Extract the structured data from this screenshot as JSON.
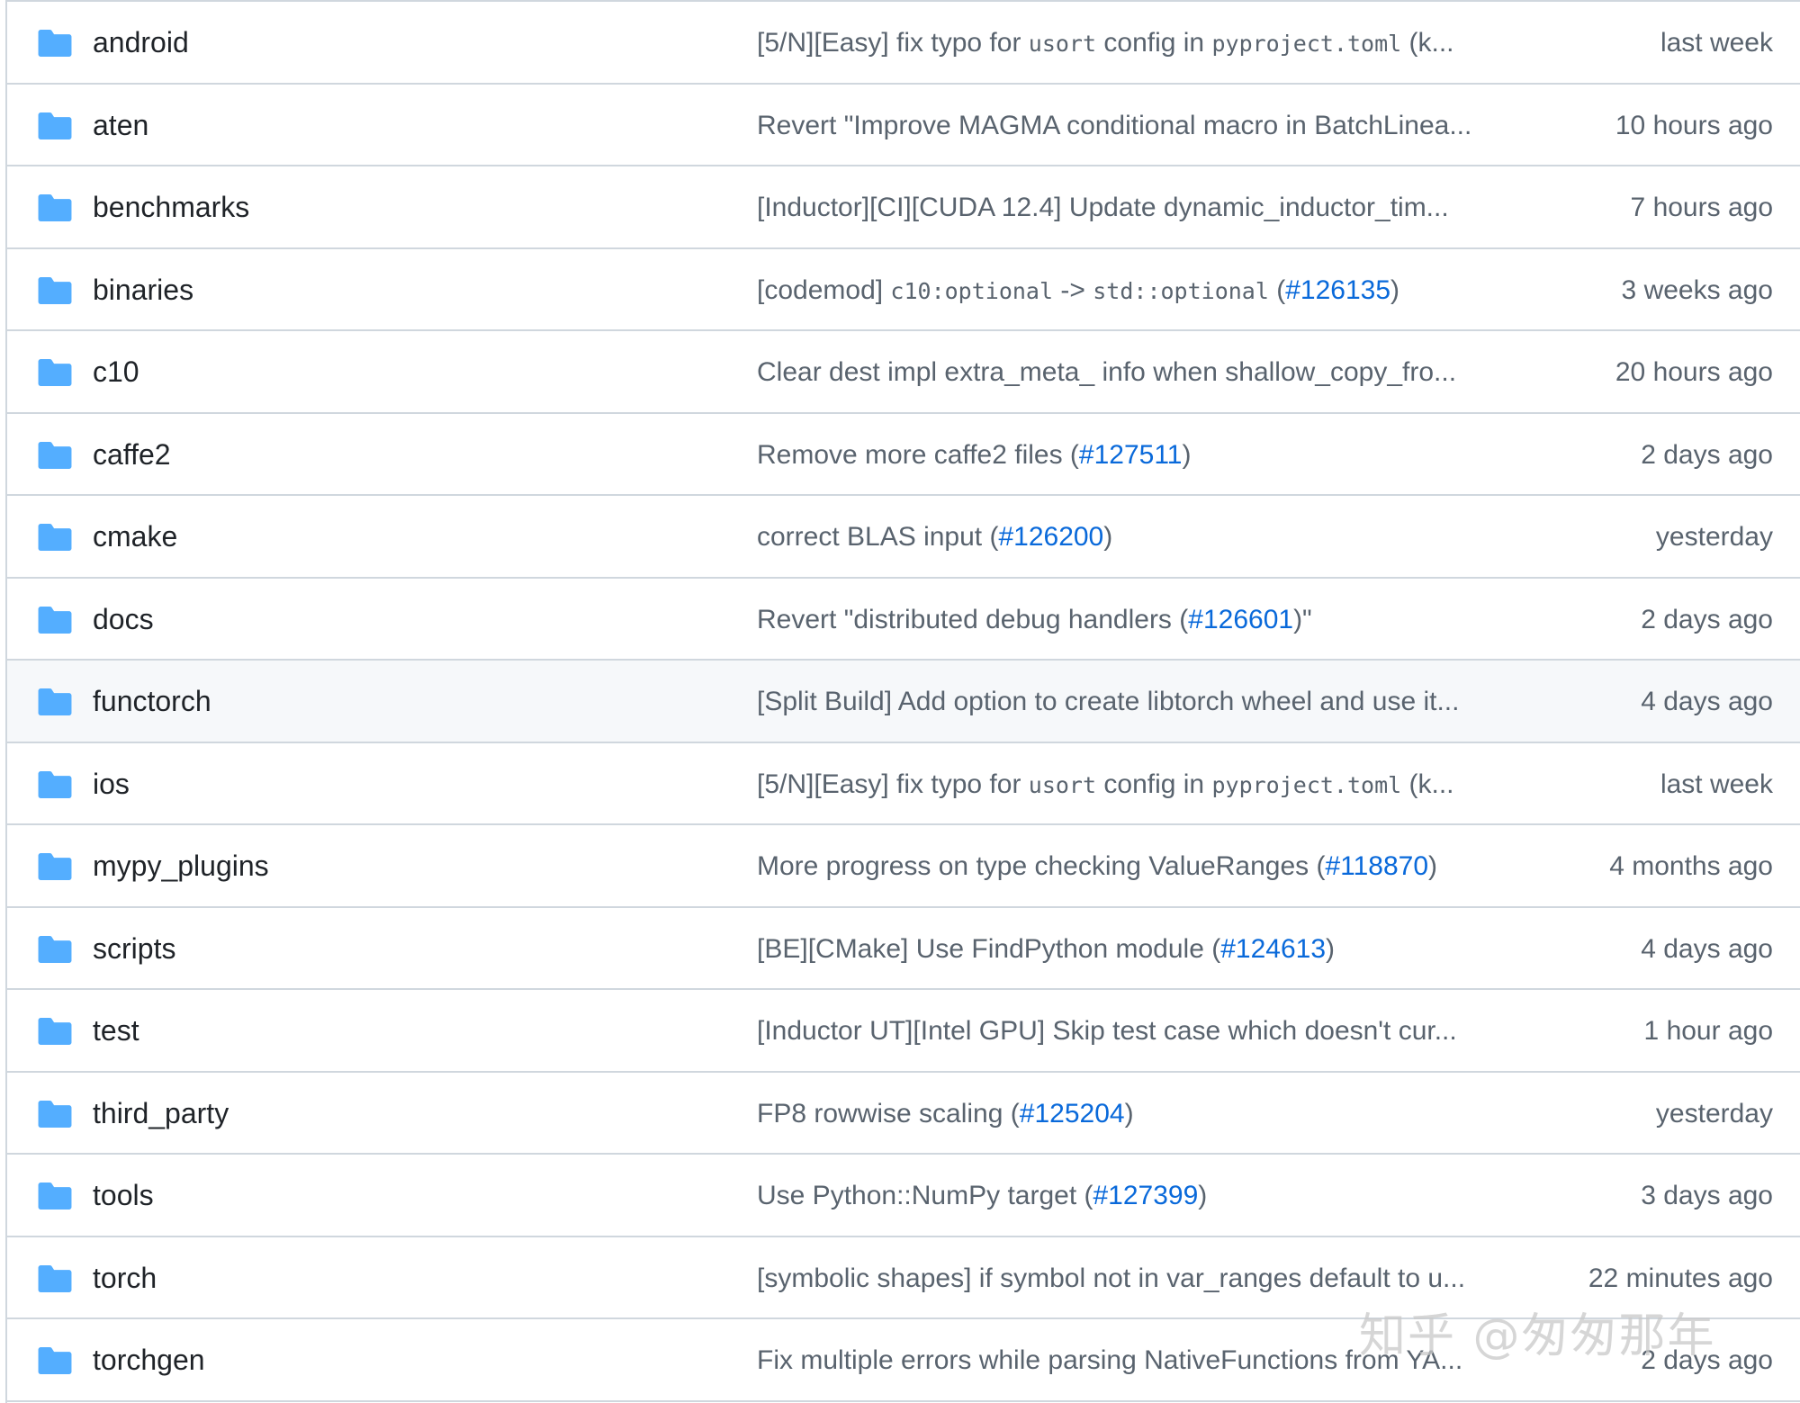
{
  "colors": {
    "folder_icon": "#54aeff",
    "link": "#0969da",
    "muted_text": "#59636e",
    "border": "#d0d7de",
    "hover_row": "#f6f8fa"
  },
  "rows": [
    {
      "name": "android",
      "icon": "folder-icon",
      "message": [
        {
          "t": "txt",
          "v": "[5/N][Easy] fix typo for "
        },
        {
          "t": "code",
          "v": "usort"
        },
        {
          "t": "txt",
          "v": " config in "
        },
        {
          "t": "code",
          "v": "pyproject.toml"
        },
        {
          "t": "txt",
          "v": " (k..."
        }
      ],
      "age": "last week"
    },
    {
      "name": "aten",
      "icon": "folder-icon",
      "message": [
        {
          "t": "txt",
          "v": "Revert \"Improve MAGMA conditional macro in BatchLinea..."
        }
      ],
      "age": "10 hours ago"
    },
    {
      "name": "benchmarks",
      "icon": "folder-icon",
      "message": [
        {
          "t": "txt",
          "v": "[Inductor][CI][CUDA 12.4] Update dynamic_inductor_tim..."
        }
      ],
      "age": "7 hours ago"
    },
    {
      "name": "binaries",
      "icon": "folder-icon",
      "message": [
        {
          "t": "txt",
          "v": "[codemod] "
        },
        {
          "t": "code",
          "v": "c10:optional"
        },
        {
          "t": "txt",
          "v": " -> "
        },
        {
          "t": "code",
          "v": "std::optional"
        },
        {
          "t": "txt",
          "v": " ("
        },
        {
          "t": "pr",
          "v": "#126135"
        },
        {
          "t": "txt",
          "v": ")"
        }
      ],
      "age": "3 weeks ago"
    },
    {
      "name": "c10",
      "icon": "folder-icon",
      "message": [
        {
          "t": "txt",
          "v": "Clear dest impl extra_meta_ info when shallow_copy_fro..."
        }
      ],
      "age": "20 hours ago"
    },
    {
      "name": "caffe2",
      "icon": "folder-icon",
      "message": [
        {
          "t": "txt",
          "v": "Remove more caffe2 files ("
        },
        {
          "t": "pr",
          "v": "#127511"
        },
        {
          "t": "txt",
          "v": ")"
        }
      ],
      "age": "2 days ago"
    },
    {
      "name": "cmake",
      "icon": "folder-icon",
      "message": [
        {
          "t": "txt",
          "v": "correct BLAS input ("
        },
        {
          "t": "pr",
          "v": "#126200"
        },
        {
          "t": "txt",
          "v": ")"
        }
      ],
      "age": "yesterday"
    },
    {
      "name": "docs",
      "icon": "folder-icon",
      "message": [
        {
          "t": "txt",
          "v": "Revert \"distributed debug handlers ("
        },
        {
          "t": "pr",
          "v": "#126601"
        },
        {
          "t": "txt",
          "v": ")\""
        }
      ],
      "age": "2 days ago"
    },
    {
      "name": "functorch",
      "icon": "folder-icon",
      "message": [
        {
          "t": "txt",
          "v": "[Split Build] Add option to create libtorch wheel and use it..."
        }
      ],
      "age": "4 days ago",
      "hover": true
    },
    {
      "name": "ios",
      "icon": "folder-icon",
      "message": [
        {
          "t": "txt",
          "v": "[5/N][Easy] fix typo for "
        },
        {
          "t": "code",
          "v": "usort"
        },
        {
          "t": "txt",
          "v": " config in "
        },
        {
          "t": "code",
          "v": "pyproject.toml"
        },
        {
          "t": "txt",
          "v": " (k..."
        }
      ],
      "age": "last week"
    },
    {
      "name": "mypy_plugins",
      "icon": "folder-icon",
      "message": [
        {
          "t": "txt",
          "v": "More progress on type checking ValueRanges ("
        },
        {
          "t": "pr",
          "v": "#118870"
        },
        {
          "t": "txt",
          "v": ")"
        }
      ],
      "age": "4 months ago"
    },
    {
      "name": "scripts",
      "icon": "folder-icon",
      "message": [
        {
          "t": "txt",
          "v": "[BE][CMake] Use FindPython module ("
        },
        {
          "t": "pr",
          "v": "#124613"
        },
        {
          "t": "txt",
          "v": ")"
        }
      ],
      "age": "4 days ago"
    },
    {
      "name": "test",
      "icon": "folder-icon",
      "message": [
        {
          "t": "txt",
          "v": "[Inductor UT][Intel GPU] Skip test case which doesn't cur..."
        }
      ],
      "age": "1 hour ago"
    },
    {
      "name": "third_party",
      "icon": "folder-icon",
      "message": [
        {
          "t": "txt",
          "v": "FP8 rowwise scaling ("
        },
        {
          "t": "pr",
          "v": "#125204"
        },
        {
          "t": "txt",
          "v": ")"
        }
      ],
      "age": "yesterday"
    },
    {
      "name": "tools",
      "icon": "folder-icon",
      "message": [
        {
          "t": "txt",
          "v": "Use Python::NumPy target ("
        },
        {
          "t": "pr",
          "v": "#127399"
        },
        {
          "t": "txt",
          "v": ")"
        }
      ],
      "age": "3 days ago"
    },
    {
      "name": "torch",
      "icon": "folder-icon",
      "message": [
        {
          "t": "txt",
          "v": "[symbolic shapes] if symbol not in var_ranges default to u..."
        }
      ],
      "age": "22 minutes ago"
    },
    {
      "name": "torchgen",
      "icon": "folder-icon",
      "message": [
        {
          "t": "txt",
          "v": "Fix multiple errors while parsing NativeFunctions from YA..."
        }
      ],
      "age": "2 days ago"
    }
  ],
  "watermark": "知乎 @匆匆那年"
}
